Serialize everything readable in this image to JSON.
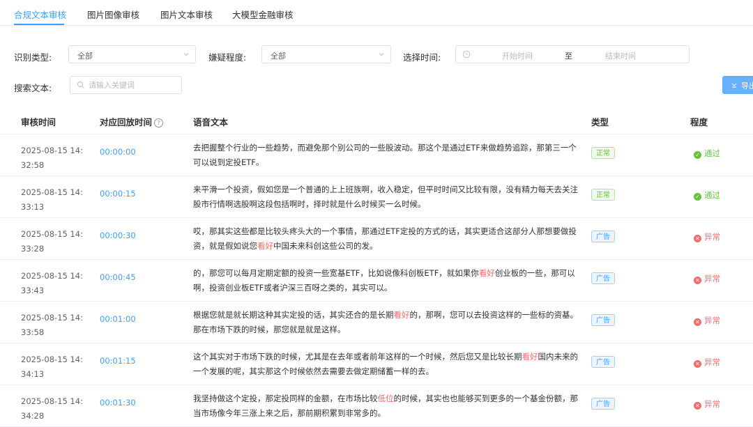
{
  "tabs": [
    {
      "label": "合规文本审核",
      "active": true
    },
    {
      "label": "图片图像审核",
      "active": false
    },
    {
      "label": "图片文本审核",
      "active": false
    },
    {
      "label": "大模型金融审核",
      "active": false
    }
  ],
  "filters": {
    "category_label": "识别类型:",
    "category_value": "全部",
    "severity_label": "嫌疑程度:",
    "severity_value": "全部",
    "time_label": "选择时间:",
    "start_placeholder": "开始时间",
    "range_separator": "至",
    "end_placeholder": "结束时间",
    "search_label": "搜索文本:",
    "search_placeholder": "请输入关键词",
    "search_value": ""
  },
  "export_label": "导出",
  "table": {
    "headers": {
      "time": "审核时间",
      "playback": "对应回放时间",
      "text": "语音文本",
      "type": "类型",
      "level": "程度"
    },
    "rows": [
      {
        "time": "2025-08-15 14:32:58",
        "playback": "00:00:00",
        "text": [
          {
            "t": "去把握整个行业的一些趋势，而避免那个别公司的一些股波动。那这个是通过ETF来做趋势追踪，那第三一个可以说到定投ETF。",
            "h": false
          }
        ],
        "type": "正常",
        "type_kind": "normal",
        "level": "通过",
        "level_kind": "pass"
      },
      {
        "time": "2025-08-15 14:33:13",
        "playback": "00:00:15",
        "text": [
          {
            "t": "来平滑一个投资，假如您是一个普通的上上班族啊，收入稳定，但平时时间又比较有限，没有精力每天去关注股市行情啊选股啊这段包括啊时，择时就是什么时候买一么时候。",
            "h": false
          }
        ],
        "type": "正常",
        "type_kind": "normal",
        "level": "通过",
        "level_kind": "pass"
      },
      {
        "time": "2025-08-15 14:33:28",
        "playback": "00:00:30",
        "text": [
          {
            "t": "哎，那其实这些都是比较头疼头大的一个事情，那通过ETF定投的方式的话，其实更适合这部分人那想要做投资，就是假如说您",
            "h": false
          },
          {
            "t": "看好",
            "h": true
          },
          {
            "t": "中国未来科创这些公司的发。",
            "h": false
          }
        ],
        "type": "广告",
        "type_kind": "ad",
        "level": "异常",
        "level_kind": "abn"
      },
      {
        "time": "2025-08-15 14:33:43",
        "playback": "00:00:45",
        "text": [
          {
            "t": "的，那您可以每月定期定额的投资一些宽基ETF，比如说像科创板ETF，就如果你",
            "h": false
          },
          {
            "t": "看好",
            "h": true
          },
          {
            "t": "创业板的一些，那可以啊，投资创业板ETF或者沪深三百呀之类的，其实可以。",
            "h": false
          }
        ],
        "type": "广告",
        "type_kind": "ad",
        "level": "异常",
        "level_kind": "abn"
      },
      {
        "time": "2025-08-15 14:33:58",
        "playback": "00:01:00",
        "text": [
          {
            "t": "根据您就是就长期这种其实定投的话，其实还合的是长期",
            "h": false
          },
          {
            "t": "看好",
            "h": true
          },
          {
            "t": "的，那啊，您可以去投资这样的一些标的资基。那在市场下跌的时候，那您就是就是这样。",
            "h": false
          }
        ],
        "type": "广告",
        "type_kind": "ad",
        "level": "异常",
        "level_kind": "abn"
      },
      {
        "time": "2025-08-15 14:34:13",
        "playback": "00:01:15",
        "text": [
          {
            "t": "这个其实对于市场下跌的时候，尤其是在去年或者前年这样的一个时候，然后您又是比较长期",
            "h": false
          },
          {
            "t": "看好",
            "h": true
          },
          {
            "t": "国内未来的一个发展的呢，其实那这个时候依然去需要去做定期储蓄一样的去。",
            "h": false
          }
        ],
        "type": "广告",
        "type_kind": "ad",
        "level": "异常",
        "level_kind": "abn"
      },
      {
        "time": "2025-08-15 14:34:28",
        "playback": "00:01:30",
        "text": [
          {
            "t": "我坚持做这个定投，那定投同样的金额，在市场比较",
            "h": false
          },
          {
            "t": "低位",
            "h": true
          },
          {
            "t": "的时候，其实也也能够买到更多的一个基金份额，那当市场像今年三涨上来之后，那前期积累到非常多的。",
            "h": false
          }
        ],
        "type": "广告",
        "type_kind": "ad",
        "level": "异常",
        "level_kind": "abn"
      }
    ]
  }
}
